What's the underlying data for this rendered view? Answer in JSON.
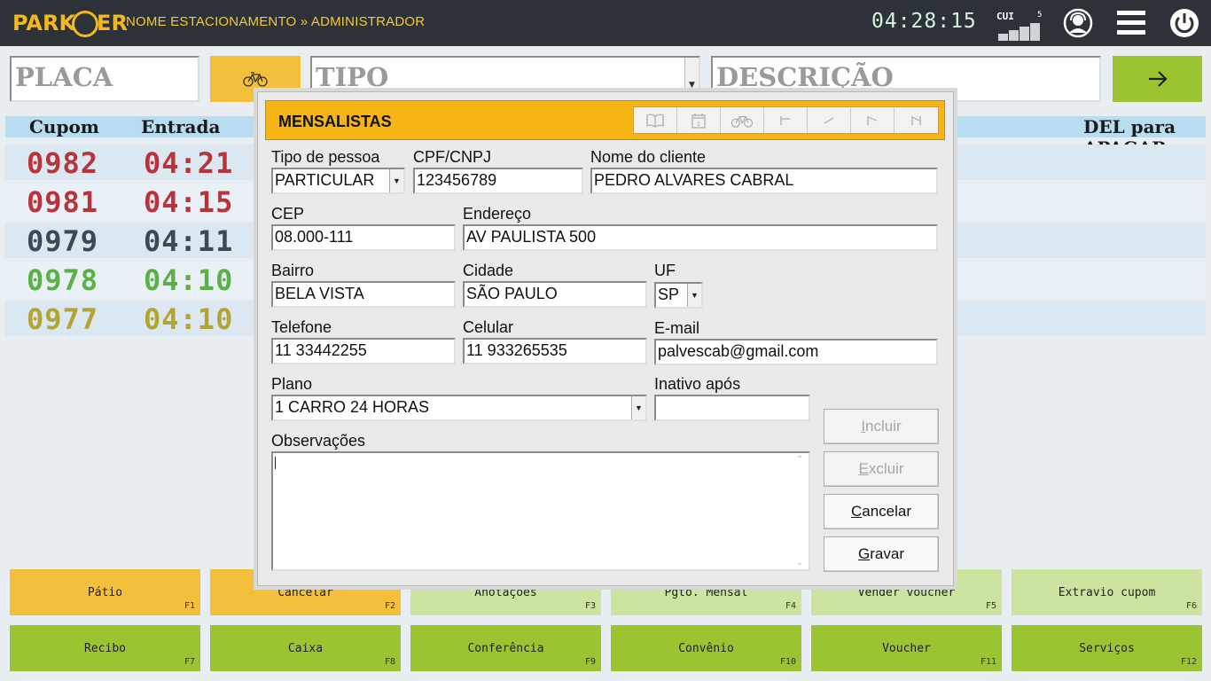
{
  "topbar": {
    "logo_left": "PARK",
    "logo_right": "ER",
    "breadcrumb": "NOME ESTACIONAMENTO » ADMINISTRADOR",
    "clock": "04:28:15",
    "signal_label": "CUI",
    "signal_count": "5",
    "signal_level": 5,
    "icons": [
      "user-support-icon",
      "menu-icon",
      "power-icon"
    ]
  },
  "entry": {
    "placa_placeholder": "PLACA",
    "tipo_placeholder": "TIPO",
    "descricao_placeholder": "DESCRIÇÃO",
    "bike_icon": "bicycle-icon",
    "go_icon": "arrow-right-icon"
  },
  "list": {
    "col_cupom": "Cupom",
    "col_entrada": "Entrada",
    "hint": "DEL para APAGAR",
    "rows": [
      {
        "cupom": "0982",
        "entrada": "04:21",
        "color": "#b8333a"
      },
      {
        "cupom": "0981",
        "entrada": "04:15",
        "color": "#b8333a"
      },
      {
        "cupom": "0979",
        "entrada": "04:11",
        "color": "#3c4a58"
      },
      {
        "cupom": "0978",
        "entrada": "04:10",
        "color": "#5bb04a"
      },
      {
        "cupom": "0977",
        "entrada": "04:10",
        "color": "#b2a536"
      }
    ]
  },
  "fkeys": [
    {
      "label": "Pátio",
      "key": "F1",
      "color": "#f4bf3b"
    },
    {
      "label": "Cancelar",
      "key": "F2",
      "color": "#f4bf3b"
    },
    {
      "label": "Anotações",
      "key": "F3",
      "color": "#cde3a0"
    },
    {
      "label": "Pgto. Mensal",
      "key": "F4",
      "color": "#cde3a0"
    },
    {
      "label": "Vender voucher",
      "key": "F5",
      "color": "#cde3a0"
    },
    {
      "label": "Extravio cupom",
      "key": "F6",
      "color": "#cde3a0"
    },
    {
      "label": "Recibo",
      "key": "F7",
      "color": "#9cc330"
    },
    {
      "label": "Caixa",
      "key": "F8",
      "color": "#9cc330"
    },
    {
      "label": "Conferência",
      "key": "F9",
      "color": "#9cc330"
    },
    {
      "label": "Convênio",
      "key": "F10",
      "color": "#9cc330"
    },
    {
      "label": "Voucher",
      "key": "F11",
      "color": "#9cc330"
    },
    {
      "label": "Serviços",
      "key": "F12",
      "color": "#9cc330"
    }
  ],
  "modal": {
    "title": "MENSALISTAS",
    "toolbar_icons": [
      "book-icon",
      "calendar-icon",
      "bicycle-icon",
      "first-record-icon",
      "previous-record-icon",
      "next-record-icon",
      "last-record-icon"
    ],
    "labels": {
      "tipo_pessoa": "Tipo de pessoa",
      "cpf": "CPF/CNPJ",
      "nome": "Nome do cliente",
      "cep": "CEP",
      "endereco": "Endereço",
      "bairro": "Bairro",
      "cidade": "Cidade",
      "uf": "UF",
      "telefone": "Telefone",
      "celular": "Celular",
      "email": "E-mail",
      "plano": "Plano",
      "inativo": "Inativo após",
      "observacoes": "Observações"
    },
    "values": {
      "tipo_pessoa": "PARTICULAR",
      "cpf": "123456789",
      "nome": "PEDRO ALVARES CABRAL",
      "cep": "08.000-111",
      "endereco": "AV PAULISTA 500",
      "bairro": "BELA VISTA",
      "cidade": "SÃO PAULO",
      "uf": "SP",
      "telefone": "11 33442255",
      "celular": "11 933265535",
      "email": "palvescab@gmail.com",
      "plano": "1 CARRO 24 HORAS",
      "inativo": "",
      "observacoes": ""
    },
    "buttons": {
      "incluir_u": "I",
      "incluir_rest": "ncluir",
      "excluir_u": "E",
      "excluir_rest": "xcluir",
      "cancelar_u": "C",
      "cancelar_rest": "ancelar",
      "gravar_u": "G",
      "gravar_rest": "ravar"
    }
  }
}
